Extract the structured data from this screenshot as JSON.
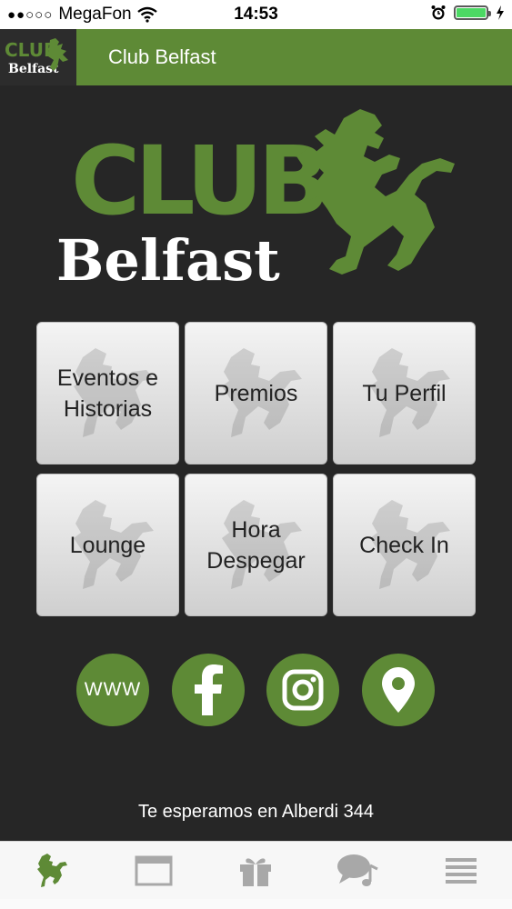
{
  "status_bar": {
    "carrier": "MegaFon",
    "time": "14:53"
  },
  "header": {
    "title": "Club Belfast",
    "logo_text_top": "CLUB",
    "logo_text_bottom": "Belfast"
  },
  "hero_logo": {
    "word_top": "CLUB",
    "word_bottom": "Belfast"
  },
  "menu": {
    "tiles": [
      {
        "label": "Eventos e\nHistorias"
      },
      {
        "label": "Premios"
      },
      {
        "label": "Tu Perfil"
      },
      {
        "label": "Lounge"
      },
      {
        "label": "Hora\nDespegar"
      },
      {
        "label": "Check In"
      }
    ]
  },
  "social": {
    "www_label": "WWW"
  },
  "footer": {
    "text": "Te esperamos en Alberdi 344"
  },
  "tabbar": {
    "items": [
      {
        "icon": "lion-icon"
      },
      {
        "icon": "browser-window-icon"
      },
      {
        "icon": "gift-icon"
      },
      {
        "icon": "chat-music-icon"
      },
      {
        "icon": "menu-lines-icon"
      }
    ]
  },
  "colors": {
    "accent": "#5e8a36",
    "background": "#262626",
    "battery": "#4cd964"
  }
}
